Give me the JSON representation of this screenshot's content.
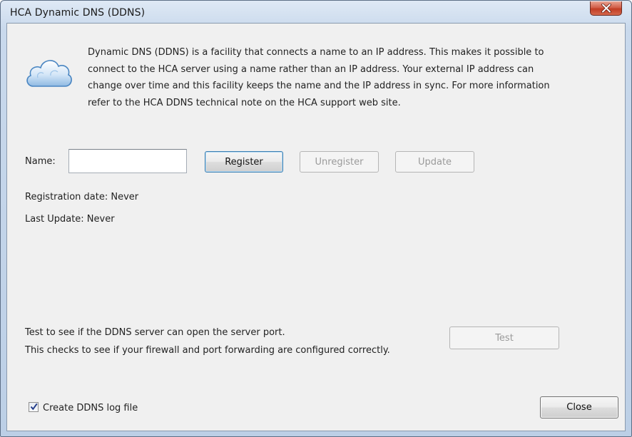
{
  "window": {
    "title": "HCA Dynamic DNS (DDNS)"
  },
  "icons": {
    "app": "cloud-icon",
    "close": "close-icon",
    "check": "checkmark-icon"
  },
  "description": {
    "lines": [
      "Dynamic DNS (DDNS) is a facility that connects a name to an IP address. This makes it possible to",
      "connect to the HCA server using a name rather than an IP address. Your external IP address can",
      "change over time and this facility keeps the name and the IP address in sync. For more information",
      "refer to the HCA DDNS technical note on the HCA support web site."
    ]
  },
  "name_field": {
    "label": "Name:",
    "value": ""
  },
  "buttons": {
    "register": "Register",
    "unregister": "Unregister",
    "update": "Update",
    "test": "Test",
    "close": "Close"
  },
  "status": {
    "registration_date": "Registration date: Never",
    "last_update": "Last Update: Never"
  },
  "test_section": {
    "line1": "Test to see if the DDNS server can open the server port.",
    "line2": "This checks to see if your firewall and port forwarding are configured correctly."
  },
  "log_option": {
    "label": "Create DDNS log file",
    "checked": true
  },
  "colors": {
    "dialog_bg": "#f0f0f0",
    "close_red": "#c23d24",
    "frame_blue": "#c9d9ec"
  }
}
